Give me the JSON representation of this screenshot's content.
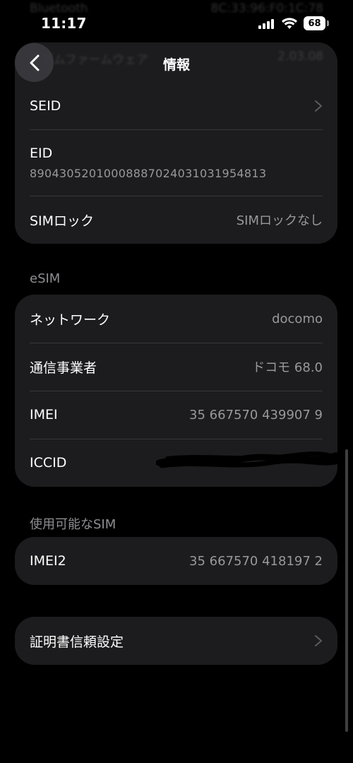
{
  "status_bar": {
    "time": "11:17",
    "battery": "68"
  },
  "header": {
    "title": "情報"
  },
  "ghost": {
    "row1_label": "Bluetooth",
    "row1_value": "8C:33:96:F0:1C:78",
    "row2_label": "モデムファームウェア",
    "row2_value": "2.03.08"
  },
  "card1": {
    "seid_label": "SEID",
    "eid_label": "EID",
    "eid_value": "89043052010008887024031031954813",
    "simlock_label": "SIMロック",
    "simlock_value": "SIMロックなし"
  },
  "esim": {
    "section_title": "eSIM",
    "network_label": "ネットワーク",
    "network_value": "docomo",
    "carrier_label": "通信事業者",
    "carrier_value": "ドコモ 68.0",
    "imei_label": "IMEI",
    "imei_value": "35 667570 439907 9",
    "iccid_label": "ICCID"
  },
  "available_sim": {
    "section_title": "使用可能なSIM",
    "imei2_label": "IMEI2",
    "imei2_value": "35 667570 418197 2"
  },
  "cert": {
    "label": "証明書信頼設定"
  },
  "icons": {
    "back": "chevron-left-icon",
    "disclosure": "chevron-right-icon"
  },
  "colors": {
    "background": "#000000",
    "card": "#1c1c1e",
    "secondary_text": "#98989d",
    "separator": "#38383c"
  }
}
